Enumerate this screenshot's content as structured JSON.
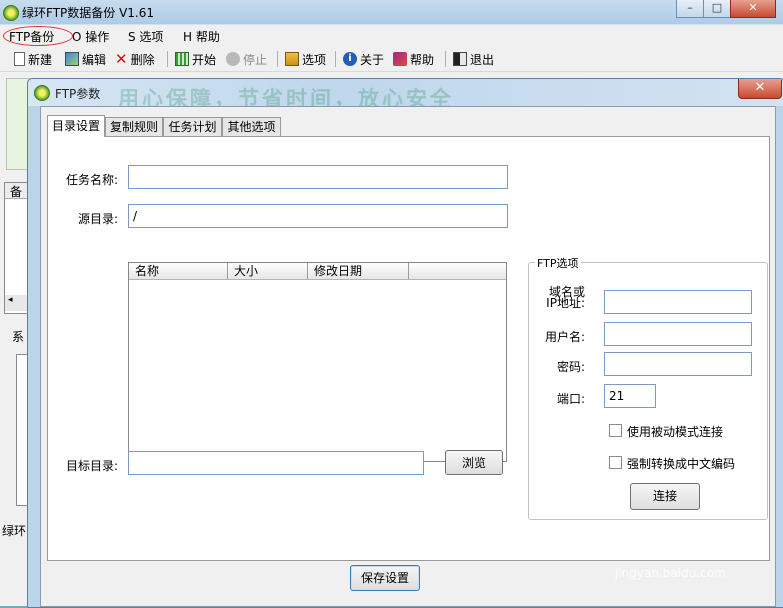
{
  "main_window": {
    "title": "绿环FTP数据备份 V1.61",
    "controls": {
      "minimize": "–",
      "maximize": "□",
      "close": "✕"
    }
  },
  "menu": [
    {
      "label": "FTP备份"
    },
    {
      "label": "O 操作"
    },
    {
      "label": "S 选项"
    },
    {
      "label": "H 帮助"
    }
  ],
  "toolbar": {
    "new": "新建",
    "edit": "编辑",
    "delete": "删除",
    "start": "开始",
    "stop": "停止",
    "options": "选项",
    "about": "关于",
    "help": "帮助",
    "exit": "退出"
  },
  "background": {
    "list_fragment": "备",
    "tab_fragment": "系",
    "status_fragment": "绿环"
  },
  "dialog": {
    "title": "FTP参数",
    "banner": "用心保障，节省时间，放心安全",
    "close": "✕",
    "tabs": [
      {
        "label": "目录设置",
        "active": true
      },
      {
        "label": "复制规则",
        "active": false
      },
      {
        "label": "任务计划",
        "active": false
      },
      {
        "label": "其他选项",
        "active": false
      }
    ],
    "task_name": {
      "label": "任务名称:",
      "value": ""
    },
    "source_dir": {
      "label": "源目录:",
      "value": "/"
    },
    "file_list": {
      "columns": [
        "名称",
        "大小",
        "修改日期"
      ]
    },
    "target_dir": {
      "label": "目标目录:",
      "value": ""
    },
    "browse_label": "浏览",
    "ftp_options": {
      "title": "FTP选项",
      "host_label_line1": "域名或",
      "host_label_line2": "IP地址:",
      "host_value": "",
      "user_label": "用户名:",
      "user_value": "",
      "password_label": "密码:",
      "password_value": "",
      "port_label": "端口:",
      "port_value": "21",
      "passive_mode_label": "使用被动模式连接",
      "passive_mode_checked": false,
      "force_chinese_label": "强制转换成中文编码",
      "force_chinese_checked": false,
      "connect_label": "连接"
    },
    "save_label": "保存设置"
  },
  "watermark": {
    "main": "Bai 经验",
    "sub": "jingyan.baidu.com"
  }
}
